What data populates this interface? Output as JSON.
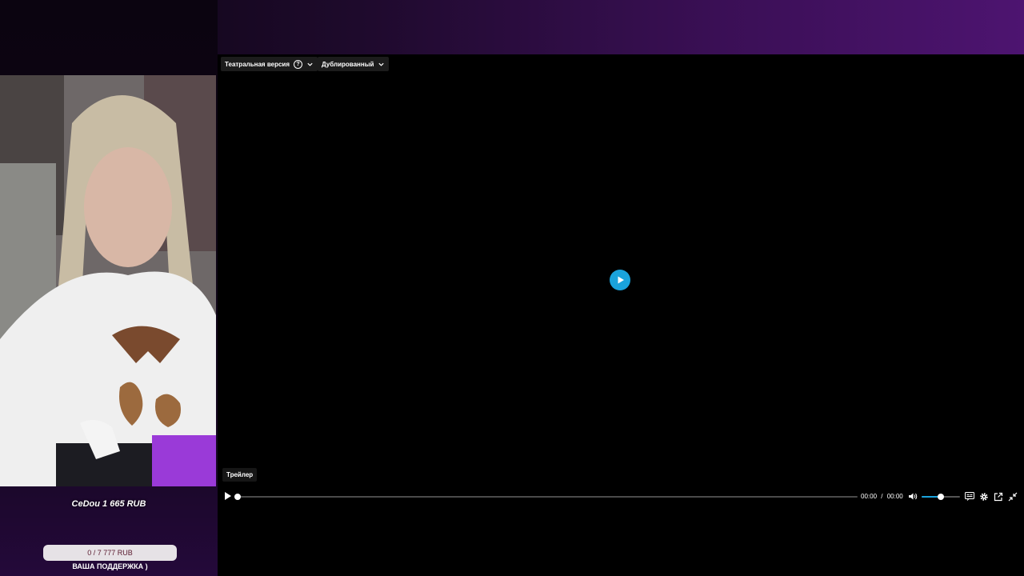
{
  "overlay": {
    "donation": "CeDou 1 665 RUB",
    "goal_text": "0 / 7 777 RUB",
    "goal_progress": 0,
    "goal_caption": "ВАША ПОДДЕРЖКА )"
  },
  "player": {
    "version_label": "Театральная версия",
    "dub_label": "Дублированный",
    "tag": "Трейлер",
    "time_current": "00:00",
    "time_separator": "/",
    "time_total": "00:00",
    "seek_progress": 0,
    "volume_level": 0.5,
    "accent_color": "#1aa3dc"
  },
  "icons": [
    "help-icon",
    "chevron-down-icon",
    "play-icon",
    "volume-icon",
    "subtitles-icon",
    "gear-icon",
    "popout-icon",
    "collapse-icon"
  ]
}
